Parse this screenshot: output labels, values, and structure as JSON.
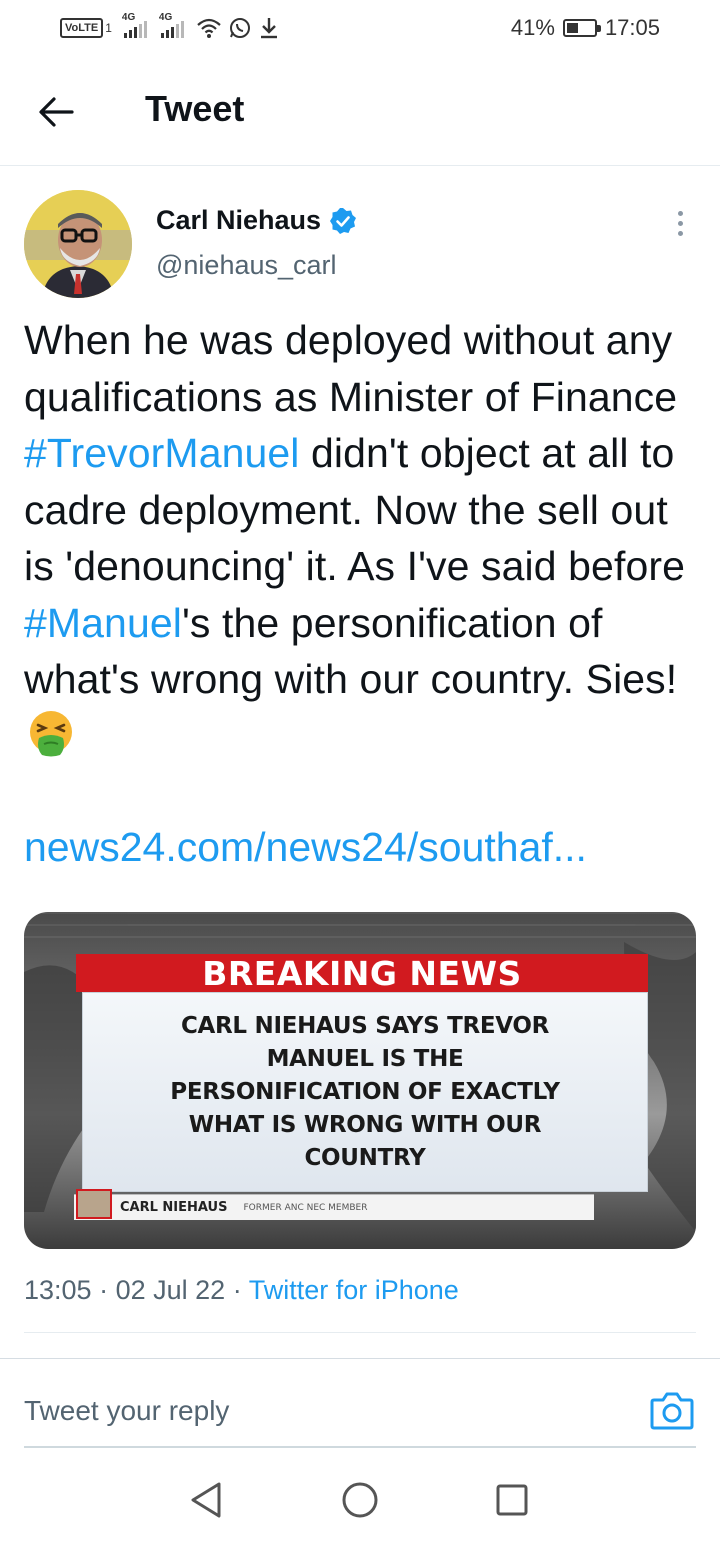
{
  "status_bar": {
    "volte": "VoLTE",
    "volte_sub": "1",
    "network_1": "4G",
    "network_2": "4G",
    "battery_percent": "41%",
    "battery_level": 0.41,
    "time": "17:05"
  },
  "header": {
    "title": "Tweet",
    "back_icon": "arrow-left-icon"
  },
  "tweet": {
    "author_name": "Carl Niehaus",
    "author_handle": "@niehaus_carl",
    "verified_icon": "verified-badge-icon",
    "text_1": "When he was deployed without any qualifications as Minister of Finance ",
    "hashtag_1": "#TrevorManuel",
    "text_2": " didn't object at all to cadre deployment. Now the sell out is 'denouncing' it. As I've said before ",
    "hashtag_2": "#Manuel",
    "text_3": "'s the personification of what's wrong with our country. Sies!",
    "emoji": "vomiting-face-emoji",
    "link": "news24.com/news24/southaf...",
    "media": {
      "banner": "BREAKING NEWS",
      "headline": "CARL NIEHAUS SAYS TREVOR MANUEL IS THE PERSONIFICATION OF EXACTLY WHAT IS WRONG WITH OUR COUNTRY",
      "caption_name": "CARL NIEHAUS",
      "caption_role": "FORMER ANC NEC MEMBER"
    },
    "time": "13:05",
    "date": "02 Jul 22",
    "source": "Twitter for iPhone",
    "separator": "·"
  },
  "reply": {
    "placeholder": "Tweet your reply"
  },
  "nav": {
    "back": "triangle-back-icon",
    "home": "circle-home-icon",
    "recents": "square-recents-icon"
  },
  "colors": {
    "accent": "#1d9bf0",
    "text": "#0f1419",
    "muted": "#536471",
    "breaking_red": "#d11a1f"
  }
}
